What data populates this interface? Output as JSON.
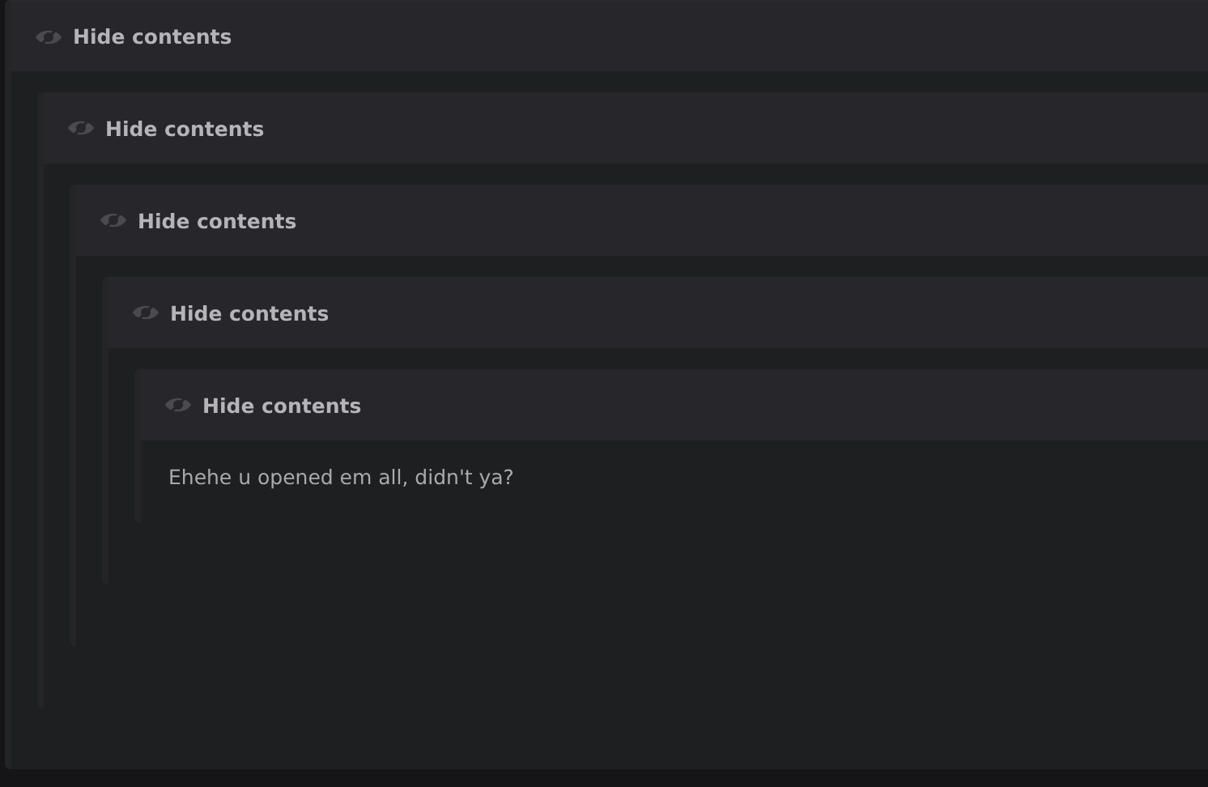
{
  "spoiler": {
    "toggle_label": "Hide contents",
    "expanded": true,
    "children": [
      {
        "toggle_label": "Hide contents",
        "expanded": true,
        "children": [
          {
            "toggle_label": "Hide contents",
            "expanded": true,
            "children": [
              {
                "toggle_label": "Hide contents",
                "expanded": true,
                "children": [
                  {
                    "toggle_label": "Hide contents",
                    "expanded": true,
                    "text": "Ehehe u opened em all, didn't ya?"
                  }
                ]
              }
            ]
          }
        ]
      }
    ]
  }
}
